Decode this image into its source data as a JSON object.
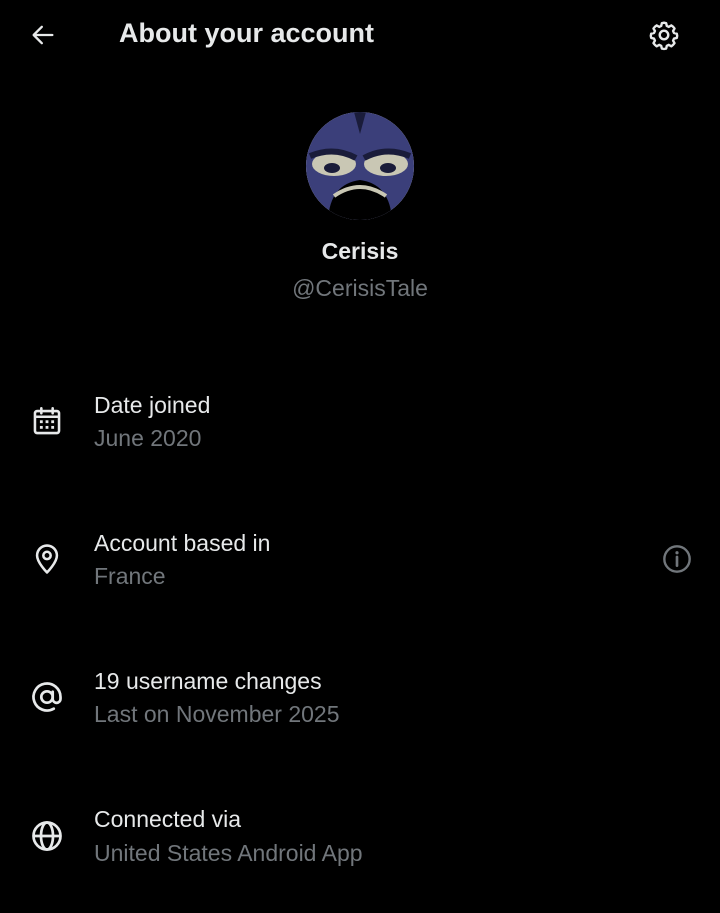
{
  "header": {
    "title": "About your account",
    "back_icon": "arrow-left-icon",
    "settings_icon": "gear-icon"
  },
  "profile": {
    "display_name": "Cerisis",
    "handle": "@CerisisTale"
  },
  "details": [
    {
      "icon": "calendar-icon",
      "title": "Date joined",
      "value": "June 2020"
    },
    {
      "icon": "location-pin-icon",
      "title": "Account based in",
      "value": "France",
      "action_icon": "info-icon"
    },
    {
      "icon": "at-sign-icon",
      "title": "19 username changes",
      "value": "Last on November 2025"
    },
    {
      "icon": "globe-icon",
      "title": "Connected via",
      "value": "United States Android App"
    }
  ],
  "colors": {
    "background": "#000000",
    "primary_text": "#e7e9ea",
    "secondary_text": "#71767b"
  }
}
